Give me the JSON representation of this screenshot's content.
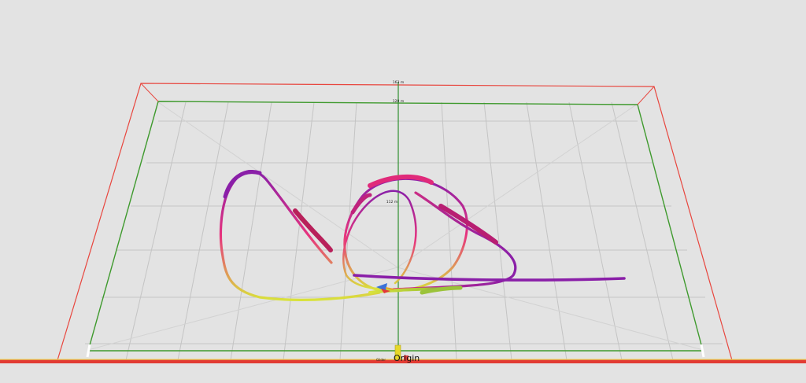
{
  "scene": {
    "background": "#e3e3e3",
    "grid_color": "#c4c4c4",
    "outer_boundary_color": "#e8463e",
    "inner_boundary_color": "#3f9a2e",
    "center_line_color": "#2f8f2f",
    "ground_line_color": "#e23b33",
    "labels": {
      "far_top": "163 m",
      "far_second": "120 m",
      "mid": "112 m",
      "origin": "Origin",
      "origin_small": "Glider"
    }
  },
  "flight_track": {
    "color_low": "#dde23a",
    "color_mid": "#e7337e",
    "color_high": "#8a1fa8"
  }
}
